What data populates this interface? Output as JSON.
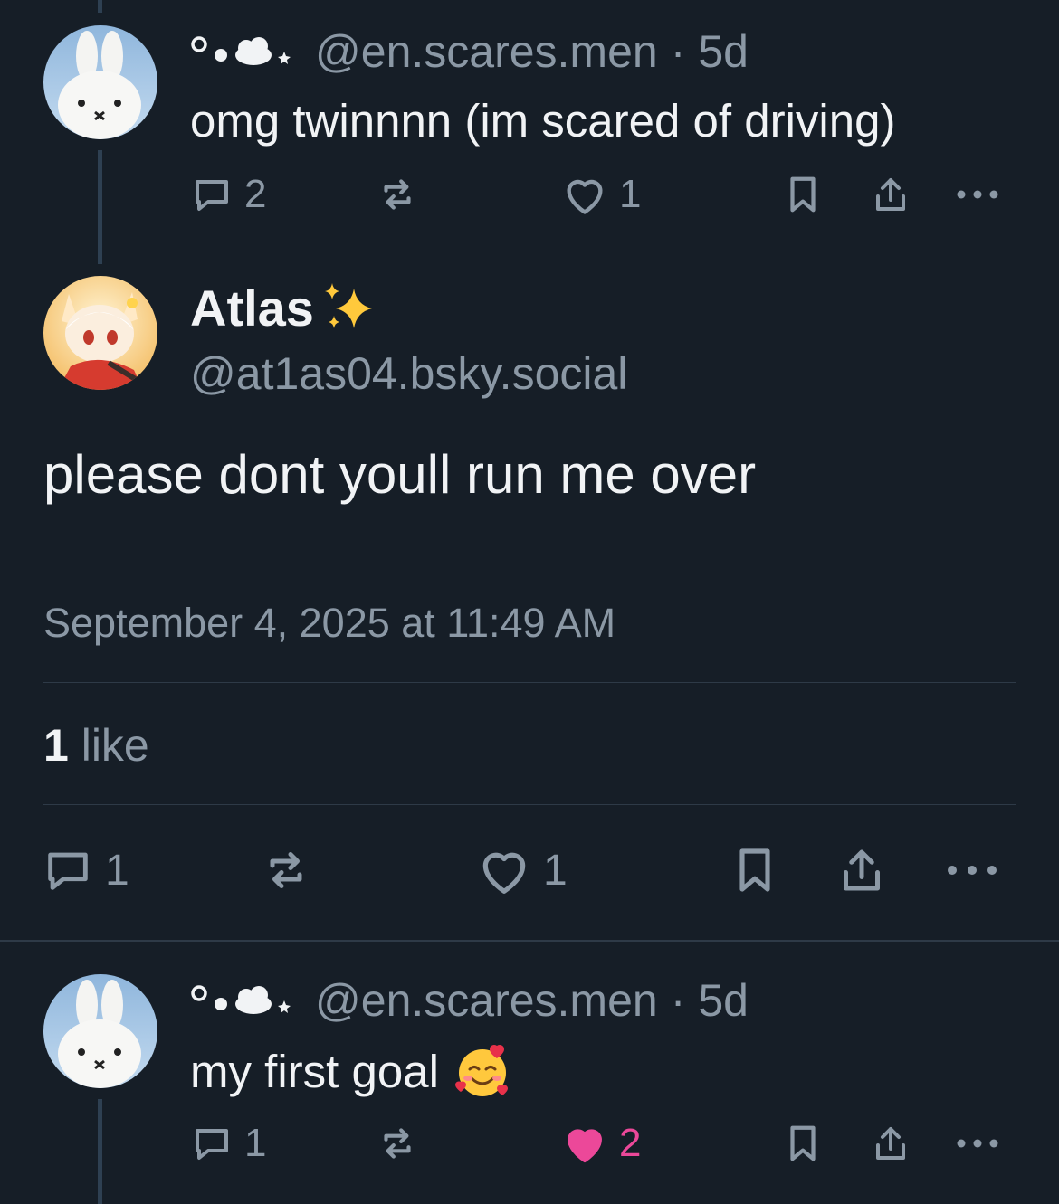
{
  "reply_top": {
    "display_name_symbols": "°•☁︎⋆",
    "handle": "@en.scares.men",
    "separator": "·",
    "age": "5d",
    "text": "omg twinnnn (im scared of driving)",
    "comments": "2",
    "reposts": "",
    "likes": "1"
  },
  "main_post": {
    "display_name": "Atlas",
    "name_emoji": "sparkles",
    "handle": "@at1as04.bsky.social",
    "text": "please dont youll run me over",
    "timestamp": "September 4, 2025 at 11:49 AM",
    "likes_count": "1",
    "likes_label": "like",
    "comments": "1",
    "reposts": "",
    "likes": "1"
  },
  "reply_bottom": {
    "display_name_symbols": "°•☁︎⋆",
    "handle": "@en.scares.men",
    "separator": "·",
    "age": "5d",
    "text": "my first goal",
    "text_emoji": "smiling-face-with-hearts",
    "comments": "1",
    "reposts": "",
    "likes": "2",
    "liked": true
  },
  "colors": {
    "background": "#161e27",
    "text_primary": "#f1f3f5",
    "text_secondary": "#8b98a5",
    "like_active": "#ec4899",
    "thread_line": "#2e4052"
  }
}
